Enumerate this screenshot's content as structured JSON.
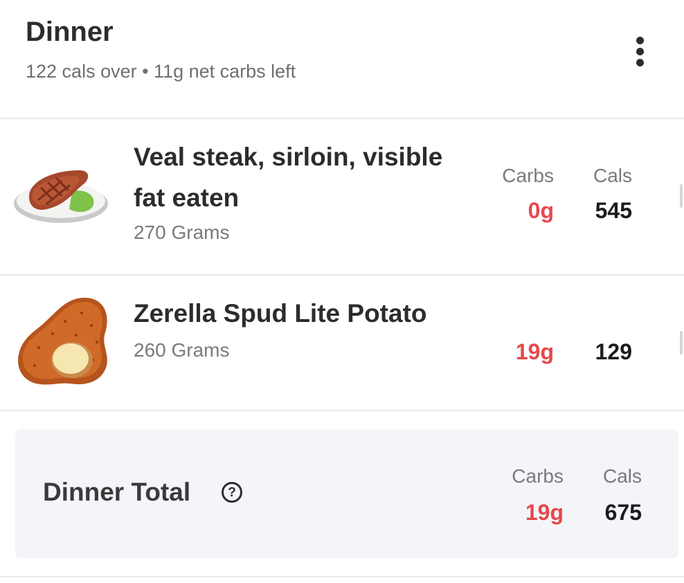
{
  "meal": {
    "title": "Dinner",
    "summary": "122 cals over • 11g net carbs left",
    "menu_icon": "more-vertical-icon"
  },
  "columns": {
    "carbs": "Carbs",
    "cals": "Cals"
  },
  "items": [
    {
      "name_line1": "Veal steak, sirloin, visible",
      "name_line2": "fat eaten",
      "portion": "270 Grams",
      "carbs": "0g",
      "cals": "545",
      "icon": "steak-icon"
    },
    {
      "name_line1": "Zerella Spud Lite Potato",
      "portion": "260 Grams",
      "carbs": "19g",
      "cals": "129",
      "icon": "potato-icon"
    }
  ],
  "total": {
    "label": "Dinner Total",
    "carbs": "19g",
    "cals": "675",
    "help_icon": "help-circle-icon",
    "help_glyph": "?"
  },
  "colors": {
    "carbs": "#e5484d",
    "cals": "#1c1c1e",
    "total_bg": "#f4f5f8"
  }
}
